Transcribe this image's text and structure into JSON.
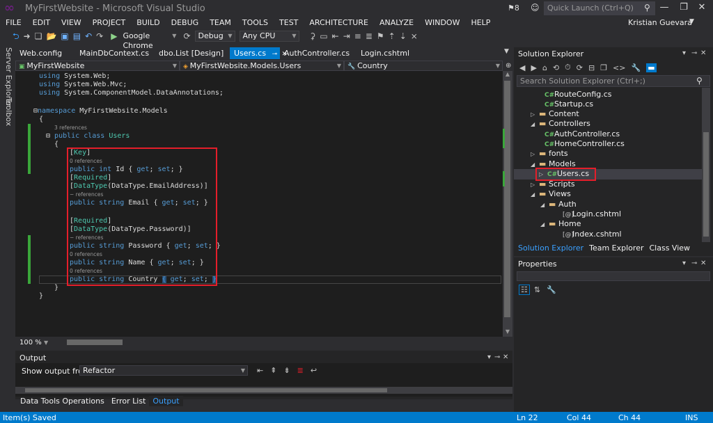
{
  "window": {
    "title": "MyFirstWebsite - Microsoft Visual Studio",
    "notifications": "8",
    "quick_launch_placeholder": "Quick Launch (Ctrl+Q)"
  },
  "menu": [
    "FILE",
    "EDIT",
    "VIEW",
    "PROJECT",
    "BUILD",
    "DEBUG",
    "TEAM",
    "TOOLS",
    "TEST",
    "ARCHITECTURE",
    "ANALYZE",
    "WINDOW",
    "HELP"
  ],
  "user": {
    "name": "Kristian Guevara"
  },
  "toolbar": {
    "browser": "Google Chrome",
    "config": "Debug",
    "platform": "Any CPU"
  },
  "side_strip": {
    "server_explorer": "Server Explorer",
    "toolbox": "Toolbox"
  },
  "tabs": [
    {
      "label": "Web.config"
    },
    {
      "label": "MainDbContext.cs"
    },
    {
      "label": "dbo.List [Design]"
    },
    {
      "label": "Users.cs",
      "pin": "⊸",
      "close": "✕",
      "active": true
    },
    {
      "label": "AuthController.cs"
    },
    {
      "label": "Login.cshtml"
    }
  ],
  "navbar": {
    "project": "MyFirstWebsite",
    "class": "MyFirstWebsite.Models.Users",
    "member": "Country"
  },
  "code": {
    "using1": "System.Web;",
    "using2": "System.Web.Mvc;",
    "using3": "System.ComponentModel.DataAnnotations;",
    "ns_name": "MyFirstWebsite.Models",
    "class_refs": "3 references",
    "class_name": "Users",
    "refs0": "0 references",
    "refs_dash": "− references",
    "attr_key": "Key",
    "attr_required": "Required",
    "attr_datatype_email": "DataType.EmailAddress",
    "attr_datatype_password": "DataType.Password",
    "prop_id": "Id",
    "prop_email": "Email",
    "prop_password": "Password",
    "prop_name": "Name",
    "prop_country": "Country"
  },
  "editor": {
    "zoom": "100 %"
  },
  "output": {
    "title": "Output",
    "show_from_label": "Show output from:",
    "source": "Refactor"
  },
  "bottom_tabs": [
    "Data Tools Operations",
    "Error List",
    "Output"
  ],
  "solution_explorer": {
    "title": "Solution Explorer",
    "search_placeholder": "Search Solution Explorer (Ctrl+;)",
    "tree": [
      {
        "label": "RouteConfig.cs",
        "icon": "csharp-file"
      },
      {
        "label": "Startup.cs",
        "icon": "csharp-file"
      },
      {
        "label": "Content",
        "icon": "folder"
      },
      {
        "label": "Controllers",
        "icon": "folder"
      },
      {
        "label": "AuthController.cs",
        "icon": "csharp-file"
      },
      {
        "label": "HomeController.cs",
        "icon": "csharp-file"
      },
      {
        "label": "fonts",
        "icon": "folder"
      },
      {
        "label": "Models",
        "icon": "folder"
      },
      {
        "label": "Users.cs",
        "icon": "csharp-file",
        "selected": true
      },
      {
        "label": "Scripts",
        "icon": "folder"
      },
      {
        "label": "Views",
        "icon": "folder"
      },
      {
        "label": "Auth",
        "icon": "folder"
      },
      {
        "label": "Login.cshtml",
        "icon": "razor-file"
      },
      {
        "label": "Home",
        "icon": "folder"
      },
      {
        "label": "Index.cshtml",
        "icon": "razor-file"
      }
    ],
    "tabs": [
      "Solution Explorer",
      "Team Explorer",
      "Class View"
    ]
  },
  "properties": {
    "title": "Properties"
  },
  "status": {
    "message": "Item(s) Saved",
    "ln": "Ln 22",
    "col": "Col 44",
    "ch": "Ch 44",
    "mode": "INS"
  },
  "colors": {
    "accent": "#007acc",
    "highlight_box": "#e51e2a",
    "keyword": "#569cd6",
    "type": "#4ec9b0"
  }
}
